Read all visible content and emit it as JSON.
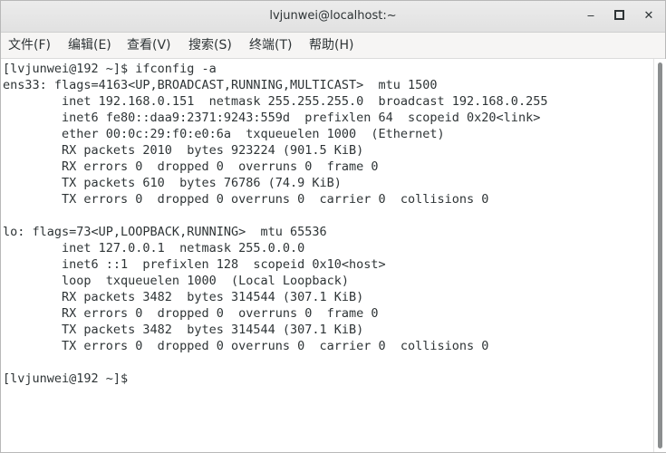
{
  "window": {
    "title": "lvjunwei@localhost:~",
    "minimize_glyph": "‒",
    "close_glyph": "✕"
  },
  "menu": [
    "文件(F)",
    "编辑(E)",
    "查看(V)",
    "搜索(S)",
    "终端(T)",
    "帮助(H)"
  ],
  "terminal": {
    "lines": [
      "[lvjunwei@192 ~]$ ifconfig -a",
      "ens33: flags=4163<UP,BROADCAST,RUNNING,MULTICAST>  mtu 1500",
      "        inet 192.168.0.151  netmask 255.255.255.0  broadcast 192.168.0.255",
      "        inet6 fe80::daa9:2371:9243:559d  prefixlen 64  scopeid 0x20<link>",
      "        ether 00:0c:29:f0:e0:6a  txqueuelen 1000  (Ethernet)",
      "        RX packets 2010  bytes 923224 (901.5 KiB)",
      "        RX errors 0  dropped 0  overruns 0  frame 0",
      "        TX packets 610  bytes 76786 (74.9 KiB)",
      "        TX errors 0  dropped 0 overruns 0  carrier 0  collisions 0",
      "",
      "lo: flags=73<UP,LOOPBACK,RUNNING>  mtu 65536",
      "        inet 127.0.0.1  netmask 255.0.0.0",
      "        inet6 ::1  prefixlen 128  scopeid 0x10<host>",
      "        loop  txqueuelen 1000  (Local Loopback)",
      "        RX packets 3482  bytes 314544 (307.1 KiB)",
      "        RX errors 0  dropped 0  overruns 0  frame 0",
      "        TX packets 3482  bytes 314544 (307.1 KiB)",
      "        TX errors 0  dropped 0 overruns 0  carrier 0  collisions 0",
      "",
      "[lvjunwei@192 ~]$"
    ]
  }
}
